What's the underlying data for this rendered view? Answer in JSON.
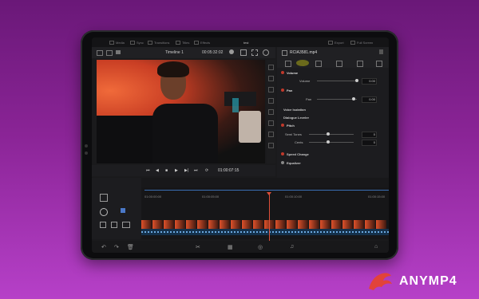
{
  "menubar": {
    "items": [
      "Media",
      "Sync",
      "Transitions",
      "Titles",
      "Effects"
    ],
    "project": "test",
    "right_items": [
      "Export",
      "Full Screen"
    ]
  },
  "viewer": {
    "timeline_name": "Timeline 1",
    "timecode": "00:05:32:02",
    "transport_timecode": "01:00:07:15"
  },
  "inspector": {
    "clip_name": "RCIA3581.mp4",
    "volume_label": "Volume",
    "volume_sub_label": "Volume",
    "volume_value": "0.00",
    "pan_label": "Pan",
    "pan_sub_label": "Pan",
    "pan_value": "0.00",
    "voice_isolation": "Voice Isolation",
    "dialogue_leveler": "Dialogue Leveler",
    "pitch_label": "Pitch",
    "semitones_label": "Semi Tones",
    "semitones_value": "0",
    "cents_label": "Cents",
    "cents_value": "0",
    "speed_change": "Speed Change",
    "equalizer": "Equalizer"
  },
  "timeline": {
    "ruler": [
      "01:00:00:00",
      "01:00:05:00",
      "01:00:10:00",
      "01:00:15:00"
    ]
  },
  "brand": {
    "name": "ANYMP4",
    "accent": "#e2433a"
  }
}
